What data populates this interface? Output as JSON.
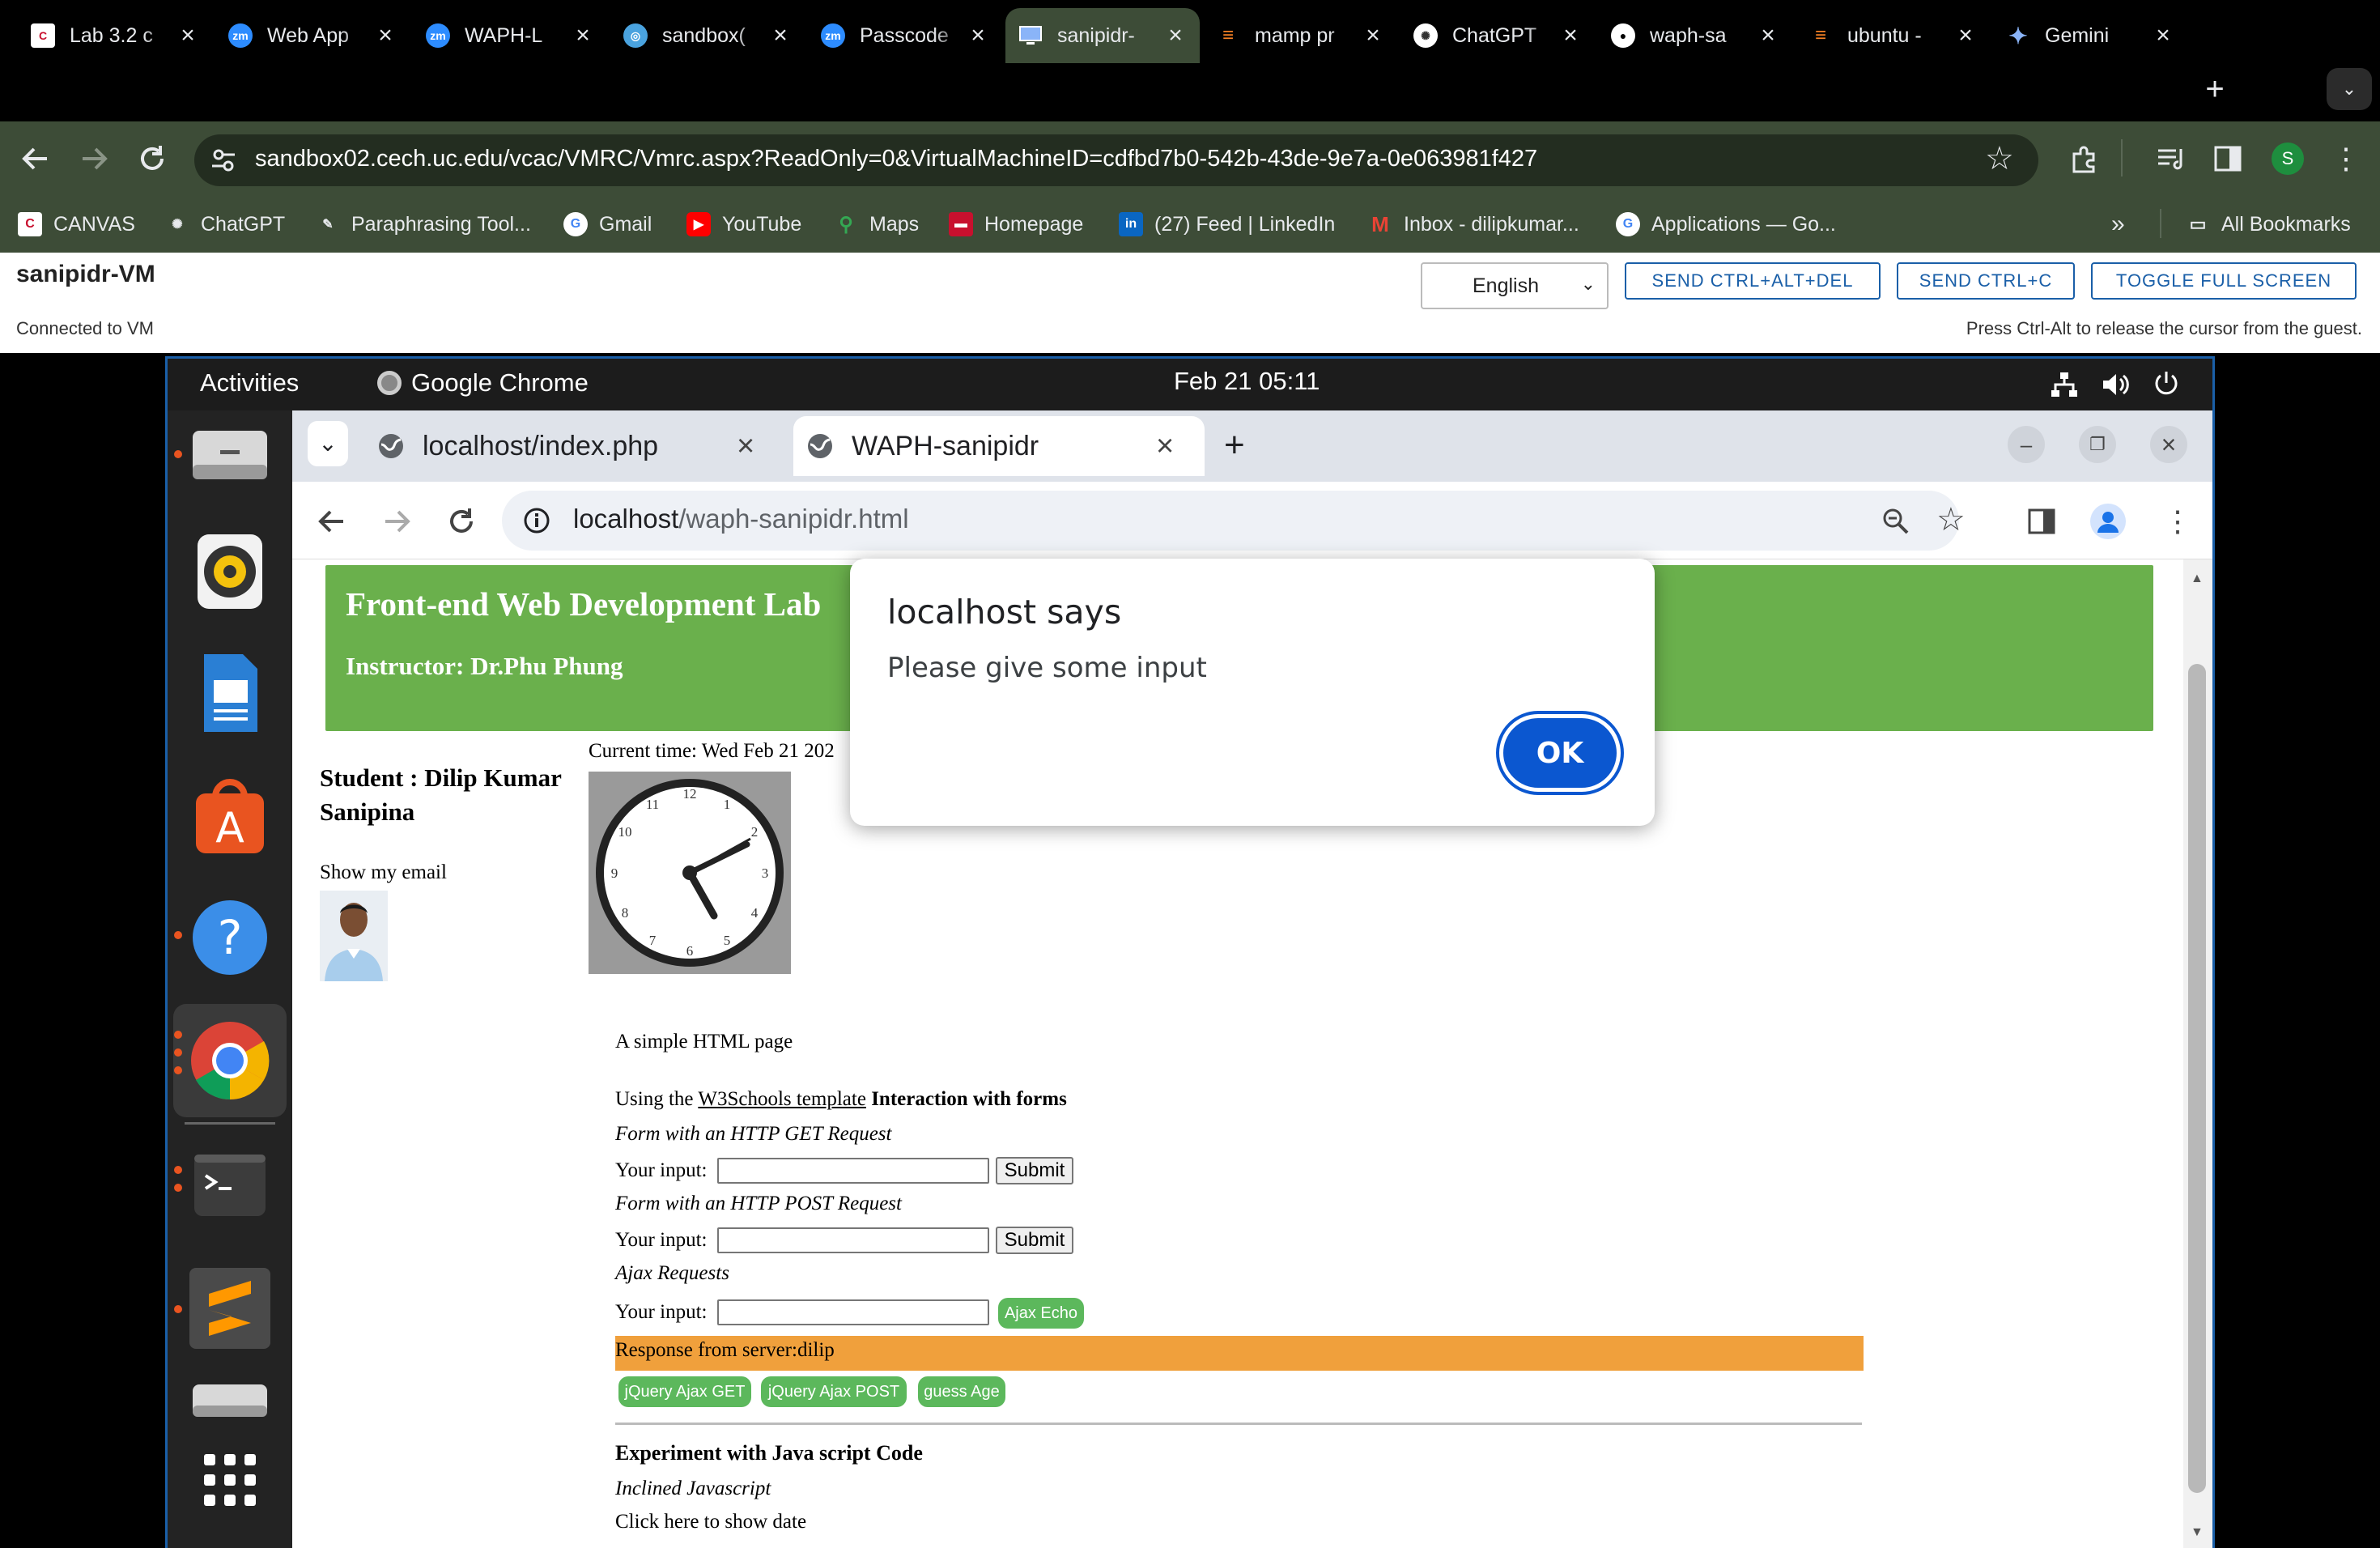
{
  "outer_browser": {
    "tabs": [
      {
        "title": "Lab 3.2 c",
        "icon": "canvas-icon"
      },
      {
        "title": "Web App",
        "icon": "zoom-icon"
      },
      {
        "title": "WAPH-L",
        "icon": "zoom-icon"
      },
      {
        "title": "sandbox(",
        "icon": "globe-icon"
      },
      {
        "title": "Passcode",
        "icon": "zoom-icon"
      },
      {
        "title": "sanipidr-",
        "icon": "monitor-icon"
      },
      {
        "title": "mamp pr",
        "icon": "stackoverflow-icon"
      },
      {
        "title": "ChatGPT",
        "icon": "chatgpt-icon"
      },
      {
        "title": "waph-sa",
        "icon": "github-icon"
      },
      {
        "title": "ubuntu -",
        "icon": "stackoverflow-icon"
      },
      {
        "title": "Gemini",
        "icon": "gemini-icon"
      }
    ],
    "active_tab_index": 5,
    "url": "sandbox02.cech.uc.edu/vcac/VMRC/Vmrc.aspx?ReadOnly=0&VirtualMachineID=cdfbd7b0-542b-43de-9e7a-0e063981f427",
    "profile_initial": "S",
    "bookmarks": [
      "CANVAS",
      "ChatGPT",
      "Paraphrasing Tool...",
      "Gmail",
      "YouTube",
      "Maps",
      "Homepage",
      "(27) Feed | LinkedIn",
      "Inbox - dilipkumar...",
      "Applications — Go..."
    ],
    "more_bookmarks": "»",
    "all_bookmarks": "All Bookmarks"
  },
  "vmrc": {
    "vm_name": "sanipidr-VM",
    "status": "Connected to VM",
    "language": "English",
    "buttons": [
      "SEND CTRL+ALT+DEL",
      "SEND CTRL+C",
      "TOGGLE FULL SCREEN"
    ],
    "hint": "Press Ctrl-Alt to release the cursor from the guest."
  },
  "ubuntu": {
    "activities": "Activities",
    "app_name": "Google Chrome",
    "clock": "Feb 21  05:11"
  },
  "inner_browser": {
    "tabs": [
      {
        "title": "localhost/index.php"
      },
      {
        "title": "WAPH-sanipidr"
      }
    ],
    "url_host": "localhost",
    "url_path": "/waph-sanipidr.html"
  },
  "page": {
    "banner_title": "Front-end Web Development Lab",
    "banner_instructor": "Instructor: Dr.Phu Phung",
    "student_line1": "Student : Dilip Kumar",
    "student_line2": "Sanipina",
    "show_email": "Show my email",
    "current_time": "Current time: Wed Feb 21 202",
    "simple_page": "A simple HTML page",
    "using_the": "Using the",
    "w3_link": "W3Schools template",
    "interaction": "Interaction with forms",
    "get_heading": "Form with an HTTP GET Request",
    "post_heading": "Form with an HTTP POST Request",
    "ajax_heading": "Ajax Requests",
    "input_label": "Your input:",
    "submit": "Submit",
    "ajax_echo": "Ajax Echo",
    "response": "Response from server:dilip",
    "jquery_get": "jQuery Ajax GET",
    "jquery_post": "jQuery Ajax POST",
    "guess_age": "guess Age",
    "experiment": "Experiment with Java script Code",
    "inline_js": "Inclined Javascript",
    "show_date": "Click here to show date"
  },
  "dialog": {
    "title": "localhost says",
    "message": "Please give some input",
    "ok": "OK"
  },
  "colors": {
    "outer_chrome": "#3d4c37",
    "banner_green": "#6ab04c",
    "response_orange": "#f0a03c",
    "dialog_ok": "#0b57d0",
    "vm_border": "#1a5fa8"
  }
}
